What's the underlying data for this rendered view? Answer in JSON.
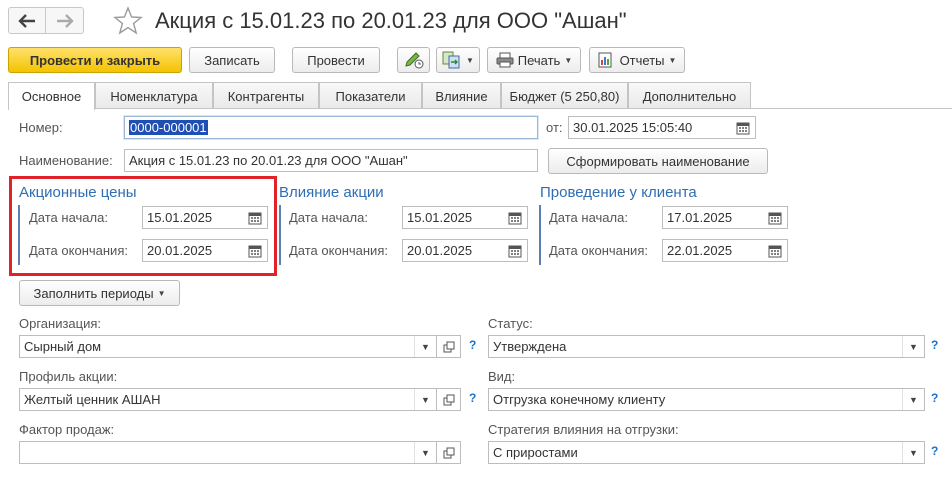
{
  "window": {
    "title": "Акция с 15.01.23 по 20.01.23 для ООО \"Ашан\""
  },
  "toolbar": {
    "post_close": "Провести и закрыть",
    "save": "Записать",
    "post": "Провести",
    "print": "Печать",
    "reports": "Отчеты"
  },
  "tabs": [
    {
      "label": "Основное"
    },
    {
      "label": "Номенклатура"
    },
    {
      "label": "Контрагенты"
    },
    {
      "label": "Показатели"
    },
    {
      "label": "Влияние"
    },
    {
      "label": "Бюджет (5 250,80)"
    },
    {
      "label": "Дополнительно"
    }
  ],
  "header": {
    "number_label": "Номер:",
    "number_value": "0000-000001",
    "date_label": "от:",
    "date_value": "30.01.2025 15:05:40",
    "name_label": "Наименование:",
    "name_value": "Акция с 15.01.23 по 20.01.23 для ООО \"Ашан\"",
    "form_name_button": "Сформировать наименование"
  },
  "groups": {
    "prices": {
      "title": "Акционные цены",
      "start_label": "Дата начала:",
      "start_value": "15.01.2025",
      "end_label": "Дата окончания:",
      "end_value": "20.01.2025"
    },
    "influence": {
      "title": "Влияние акции",
      "start_label": "Дата начала:",
      "start_value": "15.01.2025",
      "end_label": "Дата окончания:",
      "end_value": "20.01.2025"
    },
    "client": {
      "title": "Проведение у клиента",
      "start_label": "Дата начала:",
      "start_value": "17.01.2025",
      "end_label": "Дата окончания:",
      "end_value": "22.01.2025"
    }
  },
  "fill_periods": "Заполнить периоды",
  "form": {
    "org_label": "Организация:",
    "org_value": "Сырный дом",
    "status_label": "Статус:",
    "status_value": "Утверждена",
    "profile_label": "Профиль акции:",
    "profile_value": "Желтый ценник АШАН",
    "kind_label": "Вид:",
    "kind_value": "Отгрузка конечному клиенту",
    "factor_label": "Фактор продаж:",
    "factor_value": "",
    "strategy_label": "Стратегия влияния на отгрузки:",
    "strategy_value": "С приростами",
    "help_mark": "?"
  },
  "colors": {
    "primary_button": "#f4c300",
    "group_title": "#2f6db5",
    "highlight_box": "#e0232a",
    "selection": "#1f4fb5"
  }
}
